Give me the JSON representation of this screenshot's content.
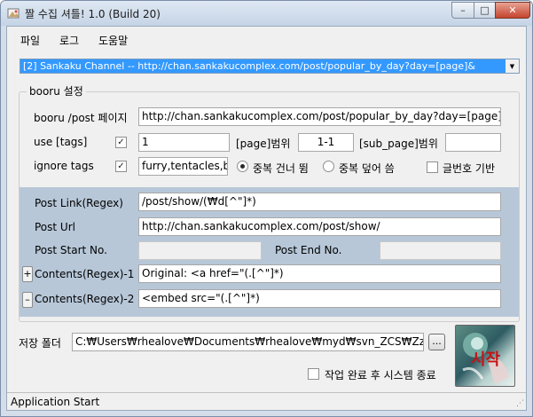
{
  "window": {
    "title": "짤 수집 셔틀! 1.0 (Build 20)",
    "min_glyph": "–",
    "max_glyph": "□",
    "close_glyph": "✕"
  },
  "menu": [
    "파일",
    "로그",
    "도움말"
  ],
  "site_select": {
    "selected": "[2] Sankaku Channel -- http://chan.sankakucomplex.com/post/popular_by_day?day=[page]&",
    "arrow": "▼"
  },
  "booru": {
    "group_title": "booru 설정",
    "post_page_label": "booru /post 페이지",
    "post_page_value": "http://chan.sankakucomplex.com/post/popular_by_day?day=[page]&n",
    "use_tags_label": "use [tags]",
    "use_tags_checked": true,
    "tags_value": "1",
    "page_range_label": "[page]범위",
    "page_range_value": "1-1",
    "sub_page_range_label": "[sub_page]범위",
    "sub_page_range_value": "",
    "ignore_tags_label": "ignore tags",
    "ignore_tags_checked": true,
    "ignore_tags_value": "furry,tentacles,be",
    "skip_dup_label": "중복 건너 뜀",
    "skip_dup_selected": true,
    "overwrite_dup_label": "중복 덮어 씀",
    "overwrite_dup_selected": false,
    "postno_based_label": "글번호 기반",
    "postno_based_checked": false
  },
  "regex": {
    "post_link_label": "Post Link(Regex)",
    "post_link_value": "/post/show/(₩d[^\"]*)",
    "post_url_label": "Post Url",
    "post_url_value": "http://chan.sankakucomplex.com/post/show/",
    "post_start_label": "Post Start No.",
    "post_start_value": "",
    "post_end_label": "Post End No.",
    "post_end_value": "",
    "add_glyph": "+",
    "remove_glyph": "–",
    "contents1_label": "Contents(Regex)-1",
    "contents1_value": "Original: <a href=\"(.[^\"]*)",
    "contents2_label": "Contents(Regex)-2",
    "contents2_value": "<embed src=\"(.[^\"]*)"
  },
  "save": {
    "folder_label": "저장 폴더",
    "folder_value": "C:₩Users₩rhealove₩Documents₩rhealove₩myd₩svn_ZCS₩ZzalC",
    "browse_label": "...",
    "shutdown_label": "작업 완료 후 시스템 종료",
    "shutdown_checked": false,
    "start_label": "시작"
  },
  "status": {
    "text": "Application Start"
  },
  "colors": {
    "selection": "#3399ff",
    "panel": "#b7c7d8",
    "start_text": "#c51414"
  }
}
